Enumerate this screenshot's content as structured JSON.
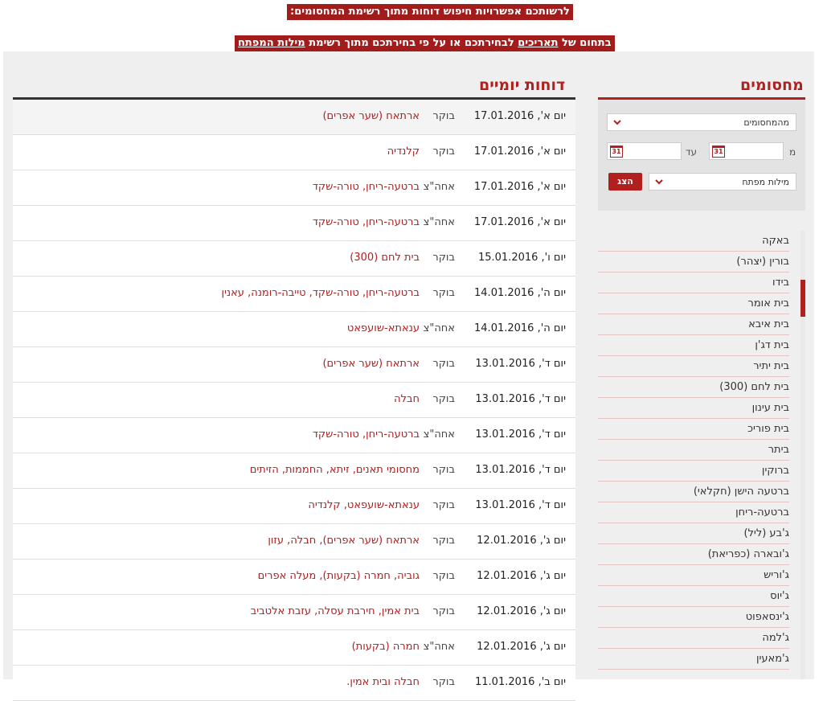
{
  "banners": {
    "line1": "לרשותכם אפשרויות חיפוש דוחות מתוך רשימת המחסומים:",
    "line2_prefix": "בתחום של ",
    "line2_link1": "תאריכים",
    "line2_mid": " לבחירתכם או על פי בחירתכם מתוך  רשימת ",
    "line2_link2": "מילות המפתח"
  },
  "sidebar": {
    "title": "מחסומים",
    "select_checkpoints": "מהמחסומים",
    "from_label": "מ",
    "to_label": "עד",
    "calendar_glyph": "31",
    "select_keywords": "מילות מפתח",
    "show_button": "הצג",
    "checkpoints": [
      "באקה",
      "בורין (יצהר)",
      "בידו",
      "בית אומר",
      "בית איבא",
      "בית דג'ן",
      "בית יתיר",
      "בית לחם (300)",
      "בית עינון",
      "בית פוריכ",
      "ביתר",
      "ברוקין",
      "ברטעה הישן (חקלאי)",
      "ברטעה-ריחן",
      "ג'בע (ליל)",
      "ג'ובארה (כפריאת)",
      "ג'וריש",
      "ג'יוס",
      "ג'ינסאפוט",
      "ג'למה",
      "ג'מאעין"
    ]
  },
  "main": {
    "title": "דוחות יומיים",
    "rows": [
      {
        "day": "יום א', 17.01.2016",
        "time": "בוקר",
        "places": "ארתאח (שער אפרים)"
      },
      {
        "day": "יום א', 17.01.2016",
        "time": "בוקר",
        "places": "קלנדיה"
      },
      {
        "day": "יום א', 17.01.2016",
        "time": "אחה\"צ",
        "places": "ברטעה-ריחן, טורה-שקד"
      },
      {
        "day": "יום א', 17.01.2016",
        "time": "אחה\"צ",
        "places": "ברטעה-ריחן, טורה-שקד"
      },
      {
        "day": "יום ו', 15.01.2016",
        "time": "בוקר",
        "places": "בית לחם (300)"
      },
      {
        "day": "יום ה', 14.01.2016",
        "time": "בוקר",
        "places": "ברטעה-ריחן, טורה-שקד, טייבה-רומנה, עאנין"
      },
      {
        "day": "יום ה', 14.01.2016",
        "time": "אחה\"צ",
        "places": "ענאתא-שועפאט"
      },
      {
        "day": "יום ד', 13.01.2016",
        "time": "בוקר",
        "places": "ארתאח (שער אפרים)"
      },
      {
        "day": "יום ד', 13.01.2016",
        "time": "בוקר",
        "places": "חבלה"
      },
      {
        "day": "יום ד', 13.01.2016",
        "time": "אחה\"צ",
        "places": "ברטעה-ריחן, טורה-שקד"
      },
      {
        "day": "יום ד', 13.01.2016",
        "time": "בוקר",
        "places": "מחסומי תאנים, זיתא, החממות, הזיתים"
      },
      {
        "day": "יום ד', 13.01.2016",
        "time": "בוקר",
        "places": "ענאתא-שועפאט, קלנדיה"
      },
      {
        "day": "יום ג', 12.01.2016",
        "time": "בוקר",
        "places": "ארתאח (שער אפרים), חבלה, עזון"
      },
      {
        "day": "יום ג', 12.01.2016",
        "time": "בוקר",
        "places": "גוביה, חמרה (בקעות), מעלה אפרים"
      },
      {
        "day": "יום ג', 12.01.2016",
        "time": "בוקר",
        "places": "בית אמין, חירבת עסלה, עזבת אלטביב"
      },
      {
        "day": "יום ג', 12.01.2016",
        "time": "אחה\"צ",
        "places": "חמרה (בקעות)"
      },
      {
        "day": "יום ב', 11.01.2016",
        "time": "בוקר",
        "places": "חבלה ובית אמין."
      }
    ]
  },
  "colors": {
    "accent": "#b11f1f",
    "banner": "#a31c1c",
    "panel": "#efefef"
  }
}
